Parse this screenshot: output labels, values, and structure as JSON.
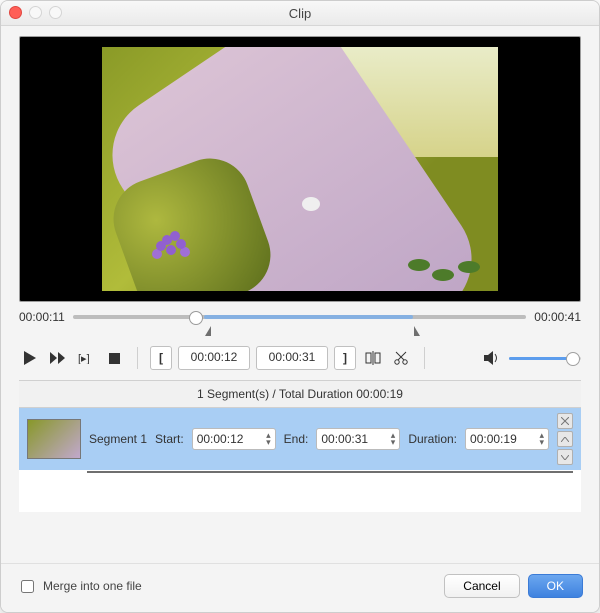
{
  "window": {
    "title": "Clip"
  },
  "player": {
    "current_time": "00:00:11",
    "total_time": "00:00:41",
    "playhead_pct": 27,
    "sel_start_pct": 29,
    "sel_end_pct": 75
  },
  "trim": {
    "set_start_glyph": "[",
    "start": "00:00:12",
    "end": "00:00:31",
    "set_end_glyph": "]"
  },
  "volume": {
    "level_pct": 88
  },
  "segments": {
    "summary": "1 Segment(s) / Total Duration 00:00:19",
    "start_label": "Start:",
    "end_label": "End:",
    "duration_label": "Duration:",
    "items": [
      {
        "name": "Segment 1",
        "start": "00:00:12",
        "end": "00:00:31",
        "duration": "00:00:19"
      }
    ]
  },
  "footer": {
    "merge_label": "Merge into one file",
    "merge_checked": false,
    "cancel": "Cancel",
    "ok": "OK"
  },
  "icons": {
    "play": "play-icon",
    "ff": "fast-forward-icon",
    "next": "next-clip-icon",
    "stop": "stop-icon",
    "split": "split-icon",
    "cut": "cut-icon",
    "volume": "volume-icon",
    "close": "close-icon",
    "up": "chevron-up-icon",
    "down": "chevron-down-icon"
  }
}
